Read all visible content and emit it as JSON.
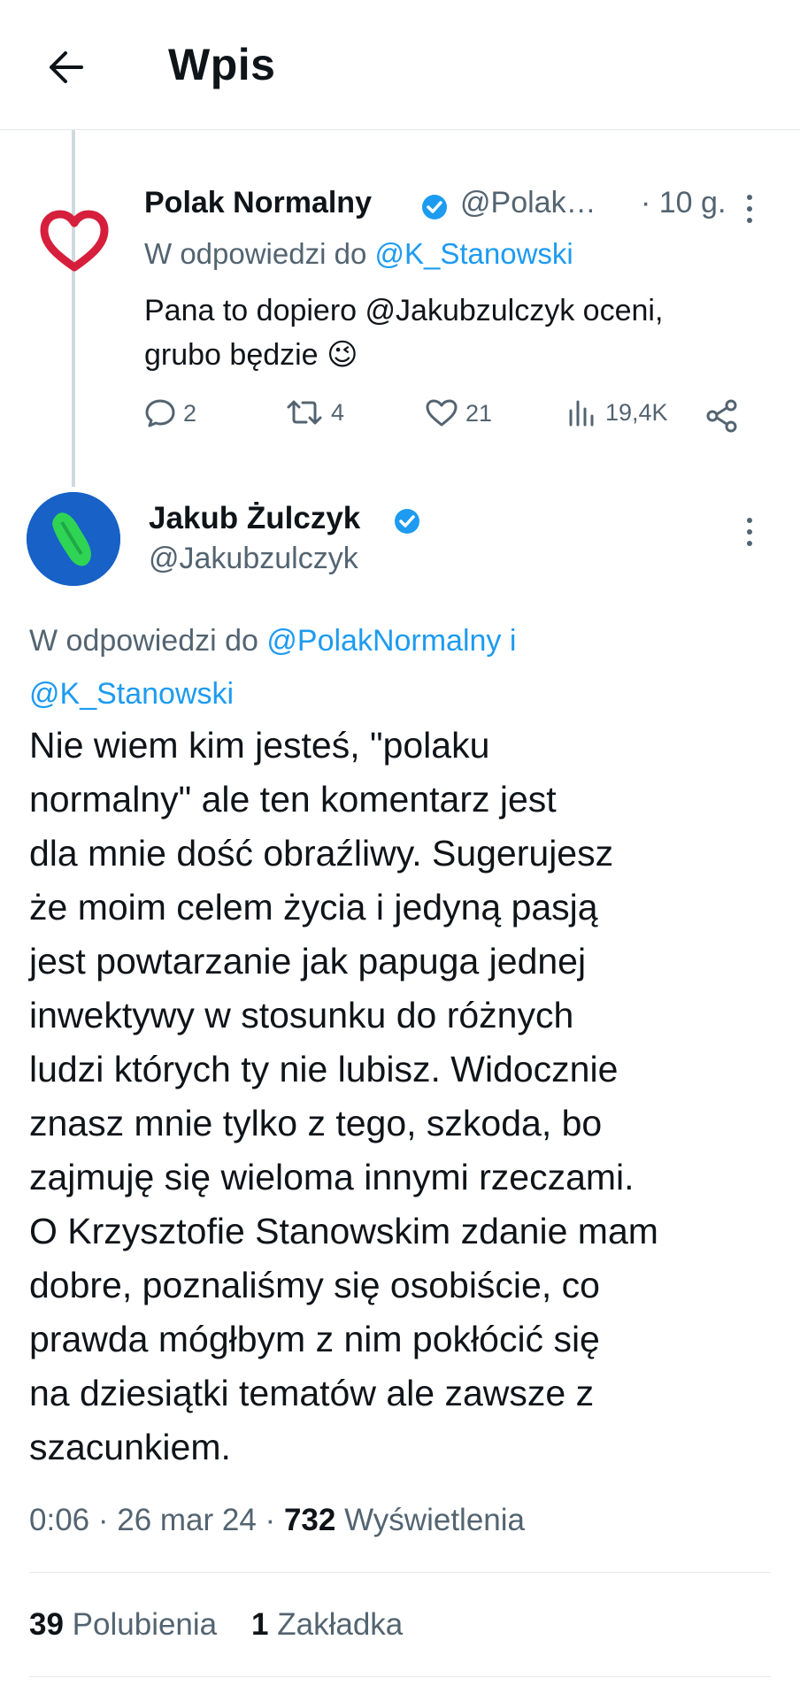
{
  "header": {
    "title": "Wpis",
    "back_icon": "arrow-left-icon"
  },
  "previous_tweet": {
    "visible": "partial"
  },
  "reply_tweet": {
    "avatar_icon": "heart-icon",
    "name": "Polak Normalny",
    "verified": true,
    "handle": "@Polak…",
    "time": "· 10 g.",
    "reply_to_prefix": "W odpowiedzi do ",
    "reply_to_mention": "@K_Stanowski",
    "text_line1": "Pana to dopiero @Jakubzulczyk oceni,",
    "text_line2": "grubo będzie",
    "emoji": "😉",
    "actions": {
      "replies": "2",
      "retweets": "4",
      "likes": "21",
      "views": "19,4K"
    }
  },
  "main_tweet": {
    "name": "Jakub Żulczyk",
    "verified": true,
    "handle": "@Jakubzulczyk",
    "reply_to_prefix": "W odpowiedzi do ",
    "reply_to_mention1": "@PolakNormalny",
    "reply_to_joiner": " i",
    "reply_to_mention2": "@K_Stanowski",
    "text": "Nie wiem kim jesteś, \"polaku\nnormalny\" ale ten komentarz jest\ndla mnie dość obraźliwy. Sugerujesz\nże moim celem życia i jedyną pasją\njest powtarzanie jak papuga jednej\ninwektywy w stosunku do różnych\nludzi których ty nie lubisz. Widocznie\nznasz mnie tylko z tego, szkoda, bo\nzajmuję się wieloma innymi rzeczami.\nO Krzysztofie Stanowskim zdanie mam\ndobre, poznaliśmy się osobiście, co\nprawda mógłbym z nim pokłócić się\nna dziesiątki tematów ale zawsze z\nszacunkiem.",
    "time": "0:06",
    "date": "26 mar 24",
    "views_count": "732",
    "views_label": "Wyświetlenia",
    "likes_count": "39",
    "likes_label": "Polubienia",
    "bookmarks_count": "1",
    "bookmarks_label": "Zakładka"
  },
  "colors": {
    "accent": "#1d9bf0",
    "muted": "#536471",
    "text": "#0f1419",
    "heart": "#e0245e"
  }
}
